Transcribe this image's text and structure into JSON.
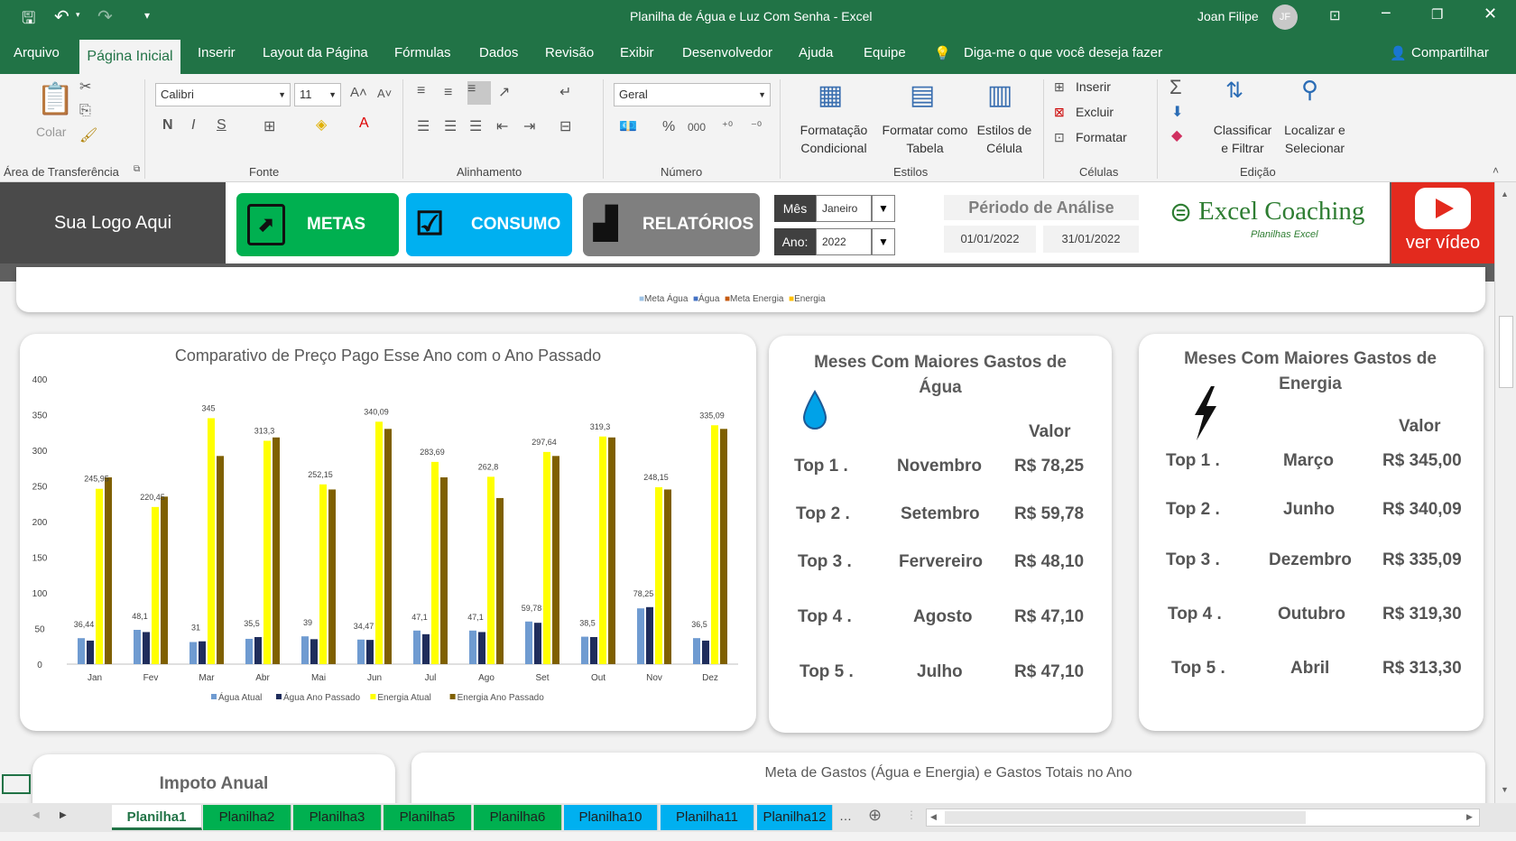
{
  "window": {
    "title": "Planilha de Água e Luz Com Senha  -  Excel",
    "user": "Joan Filipe",
    "initials": "JF"
  },
  "menu": {
    "arquivo": "Arquivo",
    "home": "Página Inicial",
    "inserir": "Inserir",
    "layout": "Layout da Página",
    "formulas": "Fórmulas",
    "dados": "Dados",
    "revisao": "Revisão",
    "exibir": "Exibir",
    "dev": "Desenvolvedor",
    "ajuda": "Ajuda",
    "equipe": "Equipe",
    "tell": "Diga-me o que você deseja fazer",
    "share": "Compartilhar"
  },
  "ribbon": {
    "clipboard": {
      "paste": "Colar",
      "label": "Área de Transferência"
    },
    "font": {
      "name": "Calibri",
      "size": "11",
      "bold": "N",
      "italic": "I",
      "underline": "S",
      "label": "Fonte"
    },
    "align": {
      "label": "Alinhamento"
    },
    "number": {
      "format": "Geral",
      "percent": "%",
      "thousands": "000",
      "label": "Número"
    },
    "styles": {
      "cond1": "Formatação",
      "cond2": "Condicional",
      "table1": "Formatar como",
      "table2": "Tabela",
      "cell1": "Estilos de",
      "cell2": "Célula",
      "label": "Estilos"
    },
    "cells": {
      "insert": "Inserir",
      "delete": "Excluir",
      "format": "Formatar",
      "label": "Células"
    },
    "edit": {
      "sort1": "Classificar",
      "sort2": "e Filtrar",
      "find1": "Localizar e",
      "find2": "Selecionar",
      "label": "Edição"
    }
  },
  "dashboard": {
    "logo": "Sua Logo Aqui",
    "nav": {
      "metas": "METAS",
      "consumo": "CONSUMO",
      "relatorios": "RELATÓRIOS"
    },
    "filters": {
      "mes_label": "Mês",
      "mes_value": "Janeiro",
      "ano_label": "Ano:",
      "ano_value": "2022"
    },
    "periodo": {
      "title": "Périodo de Análise",
      "start": "01/01/2022",
      "end": "31/01/2022"
    },
    "brand": {
      "name": "Excel Coaching",
      "sub": "Planilhas Excel"
    },
    "video": "ver vídeo",
    "top_legend": [
      "Meta Água",
      "Água",
      "Meta Energia",
      "Energia"
    ],
    "colors": {
      "agua_atual": "#6f9bd1",
      "agua_passado": "#1f2d5c",
      "energia_atual": "#ffff00",
      "energia_passado": "#7f6000",
      "green": "#00b050",
      "blue": "#00b0f0",
      "gray": "#7f7f7f",
      "red": "#e32a1e"
    }
  },
  "chart_data": {
    "type": "bar",
    "title": "Comparativo de Preço Pago Esse Ano com o Ano Passado",
    "categories": [
      "Jan",
      "Fev",
      "Mar",
      "Abr",
      "Mai",
      "Jun",
      "Jul",
      "Ago",
      "Set",
      "Out",
      "Nov",
      "Dez"
    ],
    "ylim": [
      0,
      400
    ],
    "yticks": [
      0,
      50,
      100,
      150,
      200,
      250,
      300,
      350,
      400
    ],
    "series": [
      {
        "name": "Água Atual",
        "values": [
          36.44,
          48.1,
          31,
          35.5,
          39,
          34.47,
          47.1,
          47.1,
          59.78,
          38.5,
          78.25,
          36.5
        ]
      },
      {
        "name": "Água Ano Passado",
        "values": [
          33,
          45,
          32,
          38,
          35,
          34,
          42,
          45,
          58,
          38,
          80,
          33
        ]
      },
      {
        "name": "Energia Atual",
        "values": [
          245.95,
          220.45,
          345,
          313.3,
          252.15,
          340.09,
          283.69,
          262.8,
          297.64,
          319.3,
          248.15,
          335.09
        ]
      },
      {
        "name": "Energia Ano Passado",
        "values": [
          262,
          235,
          292,
          318,
          245,
          330,
          262,
          233,
          292,
          318,
          245,
          330
        ]
      }
    ],
    "data_labels_agua": [
      "36,44",
      "48,1",
      "31",
      "35,5",
      "39",
      "34,47",
      "47,1",
      "47,1",
      "59,78",
      "38,5",
      "78,25",
      "36,5"
    ],
    "data_labels_energia": [
      "245,95",
      "220,45",
      "345",
      "313,3",
      "252,15",
      "340,09",
      "283,69",
      "262,8",
      "297,64",
      "319,3",
      "248,15",
      "335,09"
    ],
    "legend_position": "bottom",
    "grid": false
  },
  "top_agua": {
    "title": "Meses Com Maiores Gastos de Água",
    "valor_label": "Valor",
    "rows": [
      {
        "rank": "Top 1 .",
        "month": "Novembro",
        "value": "R$ 78,25"
      },
      {
        "rank": "Top 2 .",
        "month": "Setembro",
        "value": "R$ 59,78"
      },
      {
        "rank": "Top 3 .",
        "month": "Fervereiro",
        "value": "R$ 48,10"
      },
      {
        "rank": "Top 4 .",
        "month": "Agosto",
        "value": "R$ 47,10"
      },
      {
        "rank": "Top 5 .",
        "month": "Julho",
        "value": "R$ 47,10"
      }
    ]
  },
  "top_energia": {
    "title": "Meses Com Maiores Gastos de Energia",
    "valor_label": "Valor",
    "rows": [
      {
        "rank": "Top 1 .",
        "month": "Março",
        "value": "R$ 345,00"
      },
      {
        "rank": "Top 2 .",
        "month": "Junho",
        "value": "R$ 340,09"
      },
      {
        "rank": "Top 3 .",
        "month": "Dezembro",
        "value": "R$ 335,09"
      },
      {
        "rank": "Top 4 .",
        "month": "Outubro",
        "value": "R$ 319,30"
      },
      {
        "rank": "Top 5 .",
        "month": "Abril",
        "value": "R$ 313,30"
      }
    ]
  },
  "bottom": {
    "imposto": "Impoto Anual",
    "meta": "Meta de Gastos (Água e Energia) e Gastos Totais no Ano"
  },
  "sheets": [
    "Planilha1",
    "Planilha2",
    "Planilha3",
    "Planilha5",
    "Planilha6",
    "Planilha10",
    "Planilha11",
    "Planilha12"
  ],
  "sheet_colors": {
    "active": "#ffffff",
    "green": "#00b050",
    "blue": "#00b0f0"
  }
}
